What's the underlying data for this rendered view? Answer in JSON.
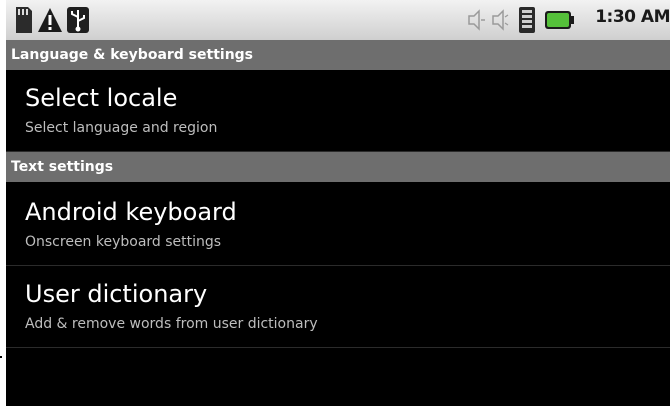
{
  "status_bar": {
    "time": "1:30 AM",
    "icons": [
      "sd-card-icon",
      "warning-icon",
      "usb-icon",
      "volume-icon",
      "signal-icon",
      "battery-icon"
    ]
  },
  "settings": {
    "section_header": "Language & keyboard settings",
    "items": [
      {
        "title": "Select locale",
        "summary": "Select language and region"
      },
      {
        "title": "Android keyboard",
        "summary": "Onscreen keyboard settings"
      },
      {
        "title": "User dictionary",
        "summary": "Add & remove words from user dictionary"
      }
    ],
    "text_settings_header": "Text settings"
  }
}
